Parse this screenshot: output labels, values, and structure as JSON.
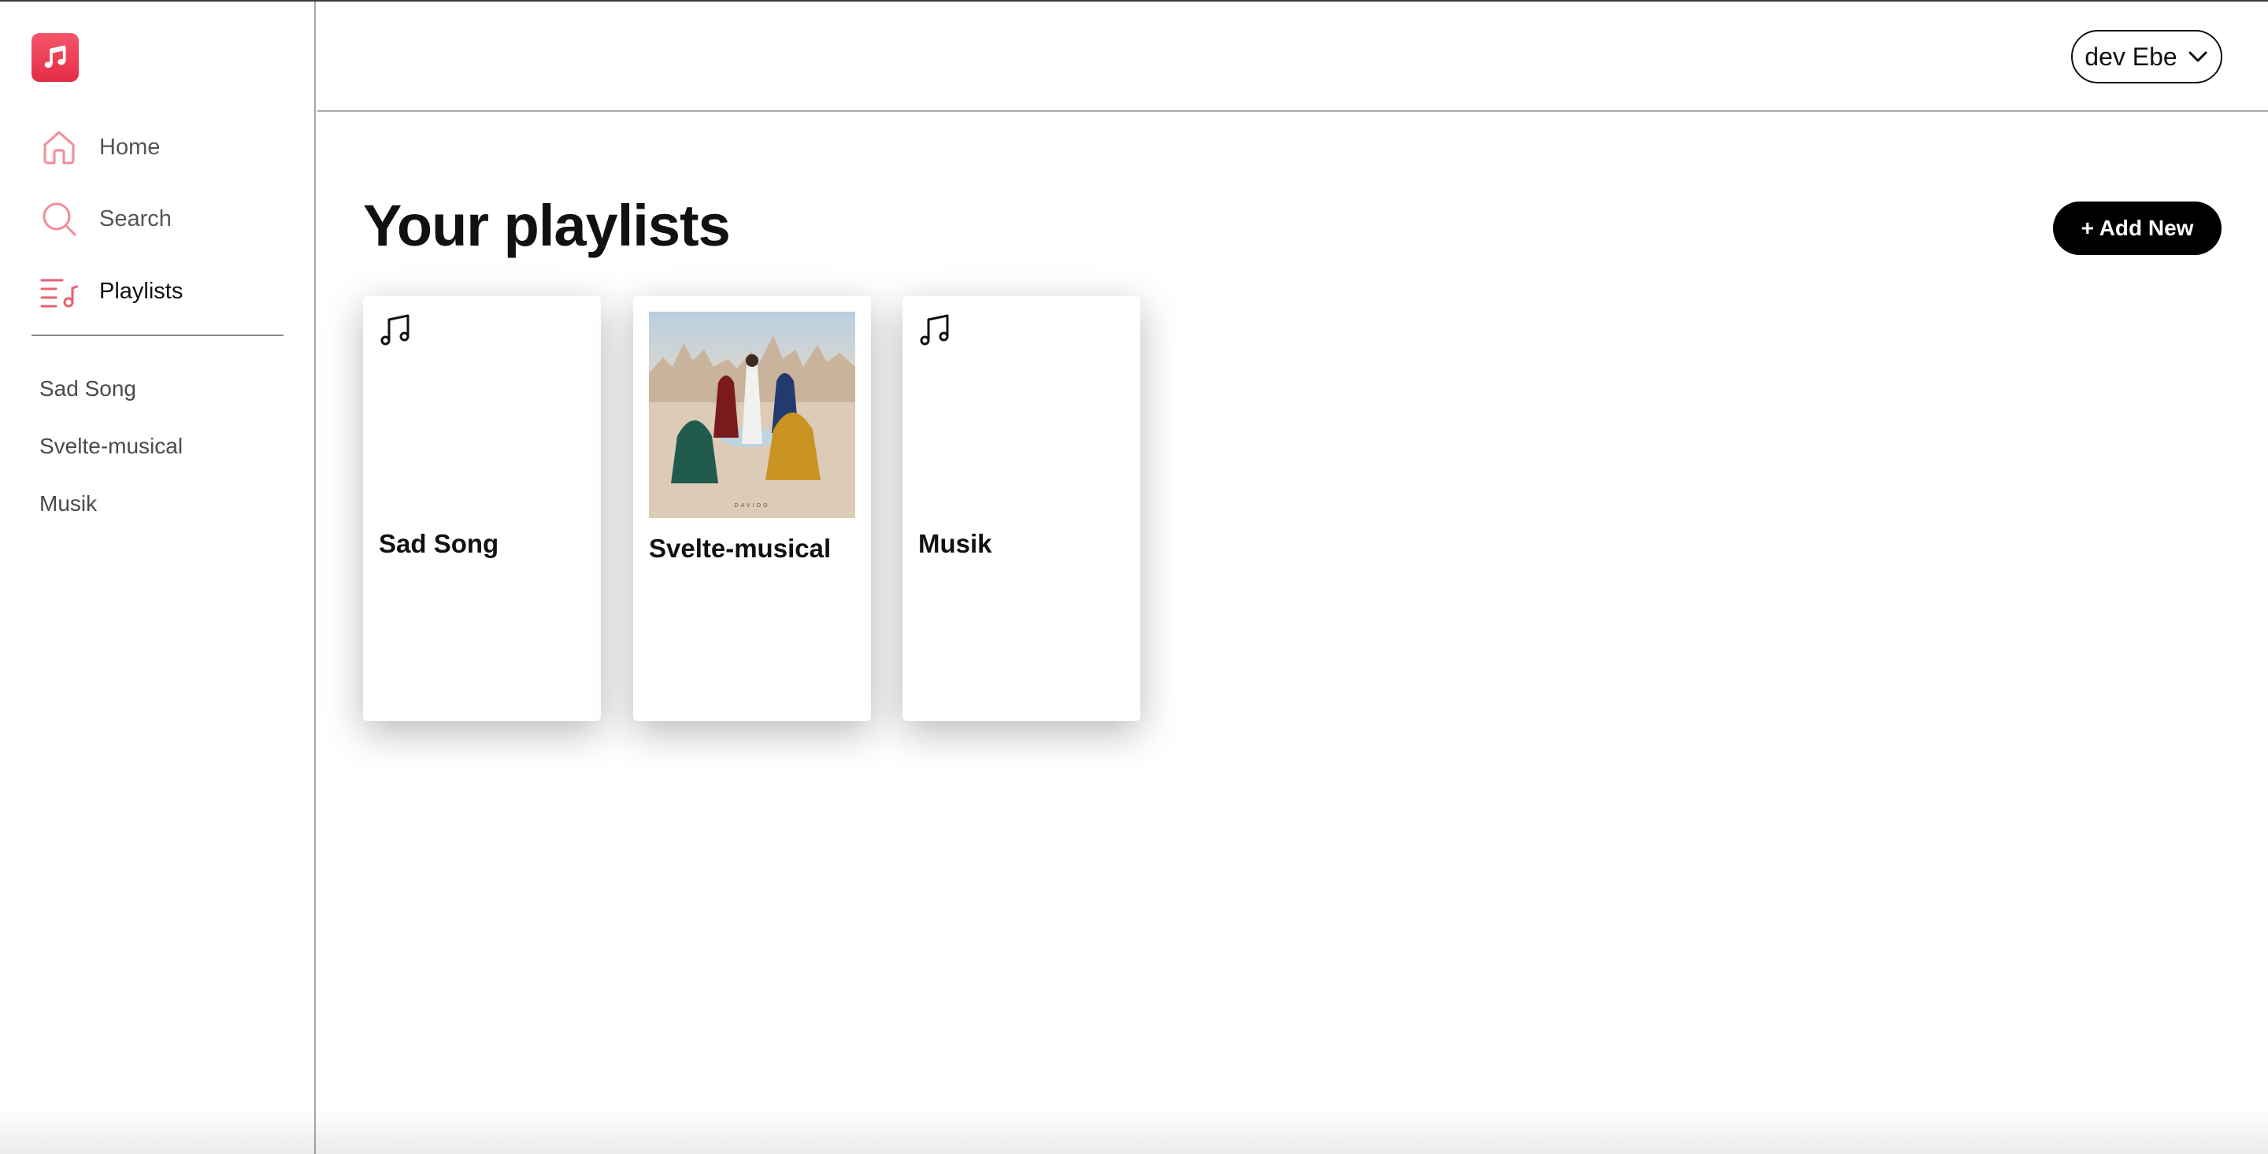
{
  "sidebar": {
    "nav": [
      {
        "label": "Home",
        "icon": "home-icon"
      },
      {
        "label": "Search",
        "icon": "search-icon"
      },
      {
        "label": "Playlists",
        "icon": "playlist-icon",
        "active": true
      }
    ],
    "playlists": [
      "Sad Song",
      "Svelte-musical",
      "Musik"
    ]
  },
  "header": {
    "user_name": "dev Ebe"
  },
  "main": {
    "title": "Your playlists",
    "add_button": "+ Add New",
    "cards": [
      {
        "title": "Sad Song",
        "icon": "music-note-icon"
      },
      {
        "title": "Svelte-musical",
        "cover": "album-cover",
        "cover_caption": "DAVIDO"
      },
      {
        "title": "Musik",
        "icon": "music-note-icon"
      }
    ]
  },
  "colors": {
    "accent": "#f26b7f",
    "logo_red": "#e8364d",
    "button_bg": "#000000"
  }
}
